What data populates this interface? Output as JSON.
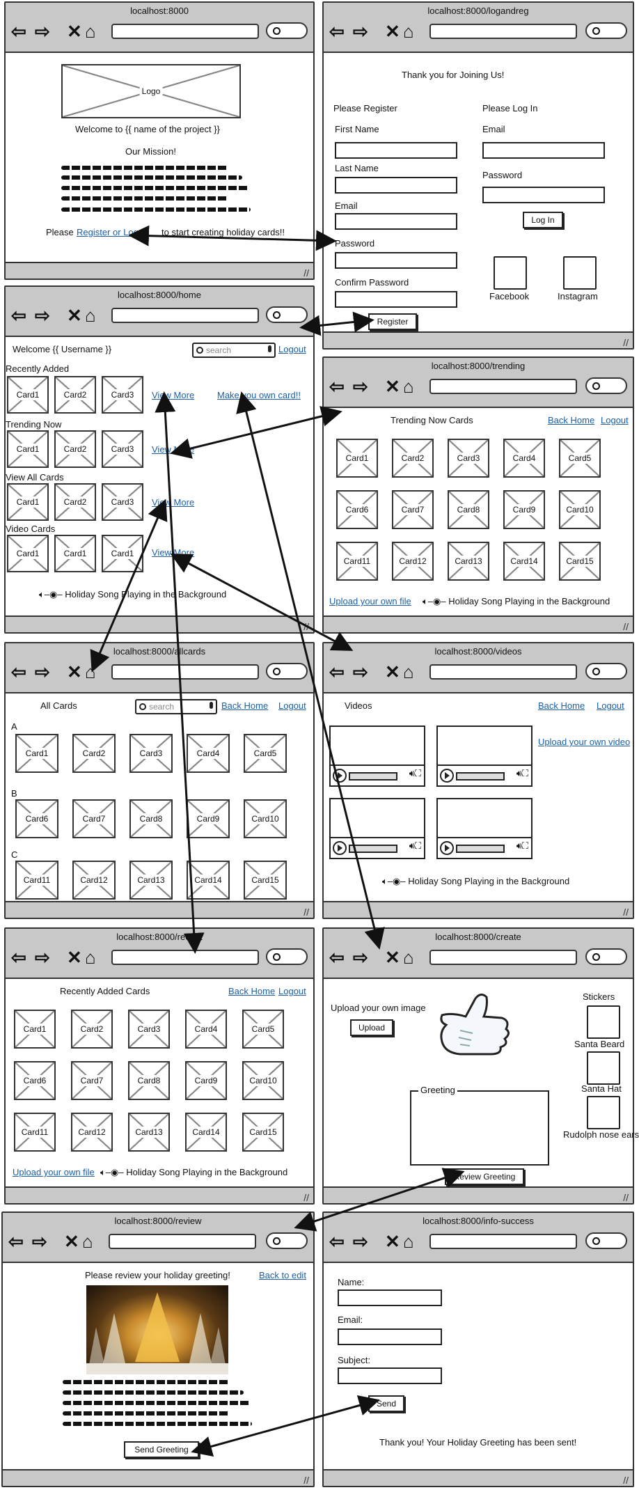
{
  "urls": {
    "w1": "localhost:8000",
    "w2": "localhost:8000/logandreg",
    "w3": "localhost:8000/home",
    "w4": "localhost:8000/trending",
    "w5": "localhost:8000/allcards",
    "w6": "localhost:8000/videos",
    "w7": "localhost:8000/recent",
    "w8": "localhost:8000/create",
    "w9": "localhost:8000/review",
    "w10": "localhost:8000/info-success"
  },
  "landing": {
    "logo": "Logo",
    "welcome": "Welcome to {{ name of the project }}",
    "mission": "Our Mission!",
    "please": "Please",
    "register_link": "Register or Log In",
    "suffix": "to start creating holiday cards!!"
  },
  "logreg": {
    "thanks": "Thank you for Joining Us!",
    "register_heading": "Please Register",
    "first_name": "First Name",
    "last_name": "Last Name",
    "email": "Email",
    "password": "Password",
    "confirm_password": "Confirm Password",
    "register_button": "Register",
    "login_heading": "Please Log In",
    "login_email": "Email",
    "login_password": "Password",
    "login_button": "Log In",
    "facebook": "Facebook",
    "instagram": "Instagram"
  },
  "home": {
    "welcome": "Welcome {{ Username }}",
    "search_placeholder": "search",
    "logout": "Logout",
    "recently_added": "Recently Added",
    "trending_now": "Trending Now",
    "view_all_cards": "View All Cards",
    "video_cards": "Video Cards",
    "view_more": "View More",
    "make_own": "Make you own card!!",
    "row_cards": [
      "Card1",
      "Card2",
      "Card3"
    ],
    "video_row": [
      "Card1",
      "Card1",
      "Card1"
    ],
    "song": "Holiday Song Playing in the Background"
  },
  "trending": {
    "title": "Trending Now Cards",
    "back_home": "Back Home",
    "logout": "Logout",
    "upload": "Upload your own file",
    "song": "Holiday Song Playing in the Background"
  },
  "allcards": {
    "title": "All Cards",
    "search_placeholder": "search",
    "back_home": "Back Home",
    "logout": "Logout",
    "sections": [
      "A",
      "B",
      "C"
    ]
  },
  "videos": {
    "title": "Videos",
    "back_home": "Back Home",
    "logout": "Logout",
    "upload_video": "Upload your own video",
    "song": "Holiday Song Playing in the Background"
  },
  "recent": {
    "title": "Recently Added Cards",
    "back_home": "Back Home",
    "logout": "Logout",
    "upload": "Upload your own file",
    "song": "Holiday Song Playing in the Background"
  },
  "create": {
    "upload_label": "Upload your own image",
    "upload_button": "Upload",
    "stickers": "Stickers",
    "sticker_names": [
      "Santa Beard",
      "Santa Hat",
      "Rudolph nose ears"
    ],
    "greeting": "Greeting",
    "review_button": "Review Greeting"
  },
  "review": {
    "title": "Please review your holiday greeting!",
    "back_to_edit": "Back to edit",
    "send_button": "Send Greeting"
  },
  "success": {
    "name": "Name:",
    "email": "Email:",
    "subject": "Subject:",
    "send": "Send",
    "message": "Thank you! Your Holiday Greeting has been sent!"
  },
  "cards15": [
    "Card1",
    "Card2",
    "Card3",
    "Card4",
    "Card5",
    "Card6",
    "Card7",
    "Card8",
    "Card9",
    "Card10",
    "Card11",
    "Card12",
    "Card13",
    "Card14",
    "Card15"
  ]
}
